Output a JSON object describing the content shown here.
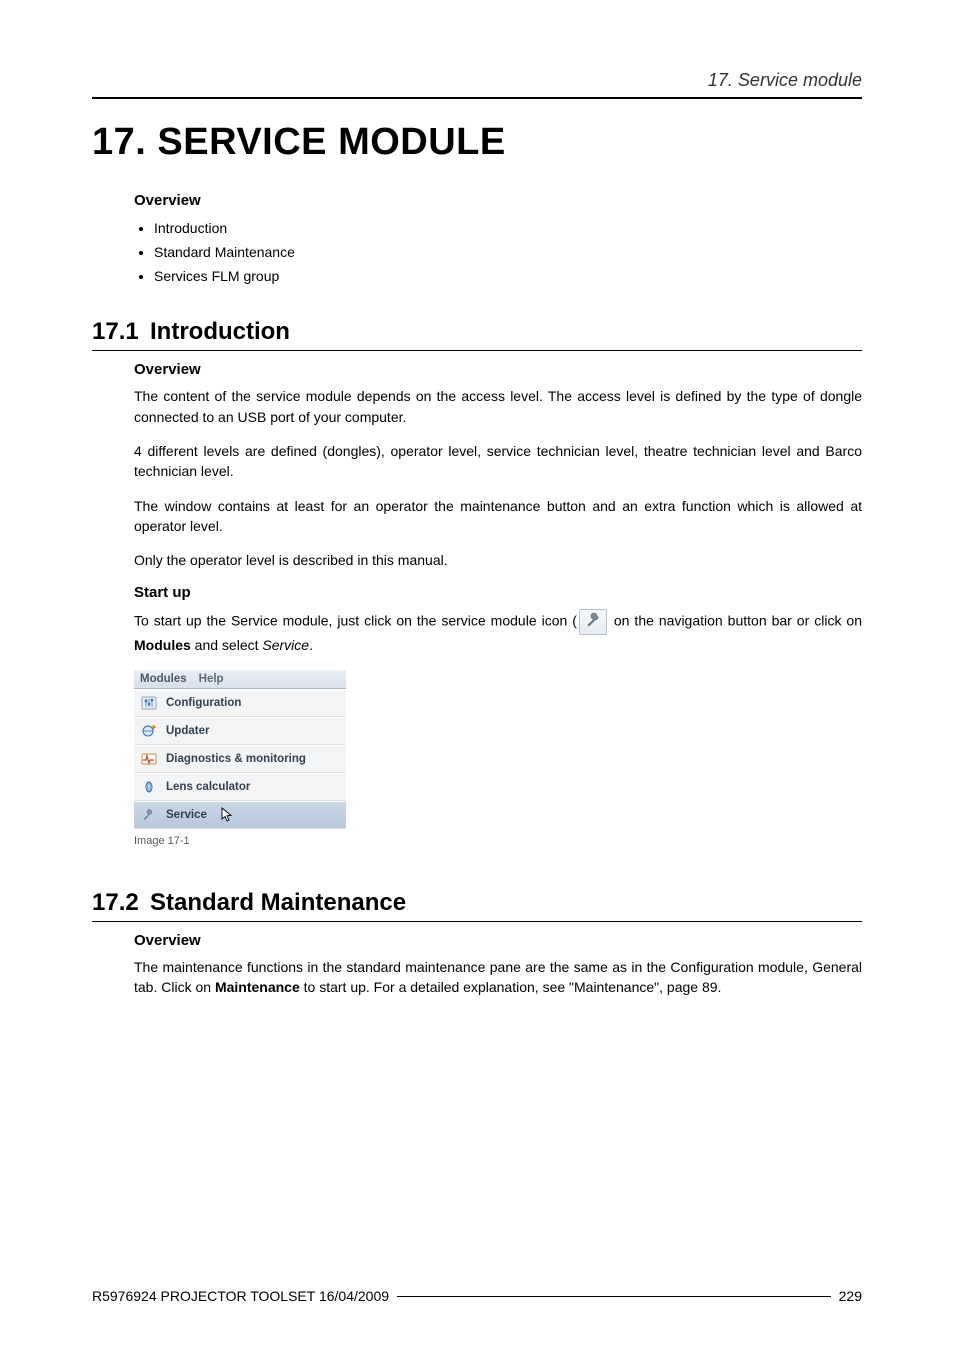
{
  "running_header": "17. Service module",
  "chapter_title": "17. SERVICE MODULE",
  "overview_heading": "Overview",
  "overview_bullets": [
    "Introduction",
    "Standard Maintenance",
    "Services FLM group"
  ],
  "sec1": {
    "num": "17.1",
    "title": "Introduction",
    "h_overview": "Overview",
    "p1": "The content of the service module depends on the access level. The access level is defined by the type of dongle connected to an USB port of your computer.",
    "p2": "4 different levels are defined (dongles), operator level, service technician level, theatre technician level and Barco technician level.",
    "p3": "The window contains at least for an operator the maintenance button and an extra function which is allowed at operator level.",
    "p4": "Only the operator level is described in this manual.",
    "h_startup": "Start up",
    "startup_pre": "To start up the Service module, just click on the service module icon (",
    "startup_post": " on the navigation button bar or click on ",
    "startup_bold": "Modules",
    "startup_tail1": " and select ",
    "startup_italic": "Service",
    "startup_tail2": ".",
    "menu": {
      "menubar": {
        "open": "Modules",
        "other": "Help"
      },
      "items": [
        {
          "label": "Configuration"
        },
        {
          "label": "Updater"
        },
        {
          "label": "Diagnostics & monitoring"
        },
        {
          "label": "Lens calculator"
        },
        {
          "label": "Service",
          "selected": true
        }
      ]
    },
    "img_caption": "Image 17-1"
  },
  "sec2": {
    "num": "17.2",
    "title": "Standard Maintenance",
    "h_overview": "Overview",
    "p1_a": "The maintenance functions in the standard maintenance pane are the same as in the Configuration module, General tab. Click on ",
    "p1_bold": "Maintenance",
    "p1_b": " to start up. For a detailed explanation, see \"Maintenance\", page 89."
  },
  "footer": {
    "left": "R5976924  PROJECTOR TOOLSET  16/04/2009",
    "right": "229"
  }
}
